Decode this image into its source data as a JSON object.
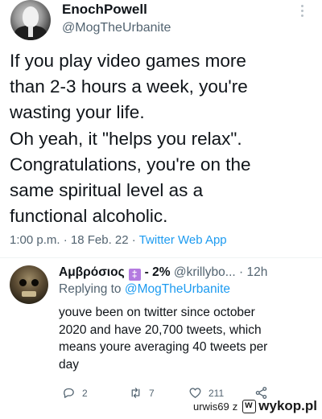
{
  "tweet": {
    "display_name": "EnochPowell",
    "handle": "@MogTheUrbanite",
    "lines": [
      "If you play video games more",
      "than 2-3 hours a week, you're",
      "wasting your life.",
      "Oh yeah, it \"helps you relax\".",
      "Congratulations, you're on the",
      "same spiritual level as a",
      "functional alcoholic."
    ],
    "time": "1:00 p.m.",
    "date": "18 Feb. 22",
    "source": "Twitter Web App",
    "separator": "·"
  },
  "reply": {
    "display_name": "Αμβρόσιος",
    "badge_glyph": "‡",
    "percent": "- 2%",
    "handle": "@krillybo...",
    "age": "· 12h",
    "replying_prefix": "Replying to",
    "replying_to": "@MogTheUrbanite",
    "lines": [
      "youve been on twitter since october",
      "2020 and have 20,700 tweets, which",
      "means youre averaging 40 tweets per",
      "day"
    ],
    "actions": {
      "reply_count": "2",
      "retweet_count": "7",
      "like_count": "211"
    }
  },
  "watermark": {
    "user": "urwis69",
    "prep": "z",
    "brand": "wykop.pl"
  },
  "colors": {
    "text": "#0f1419",
    "secondary": "#536471",
    "link": "#1d9bf0",
    "badge": "#b47be0"
  }
}
